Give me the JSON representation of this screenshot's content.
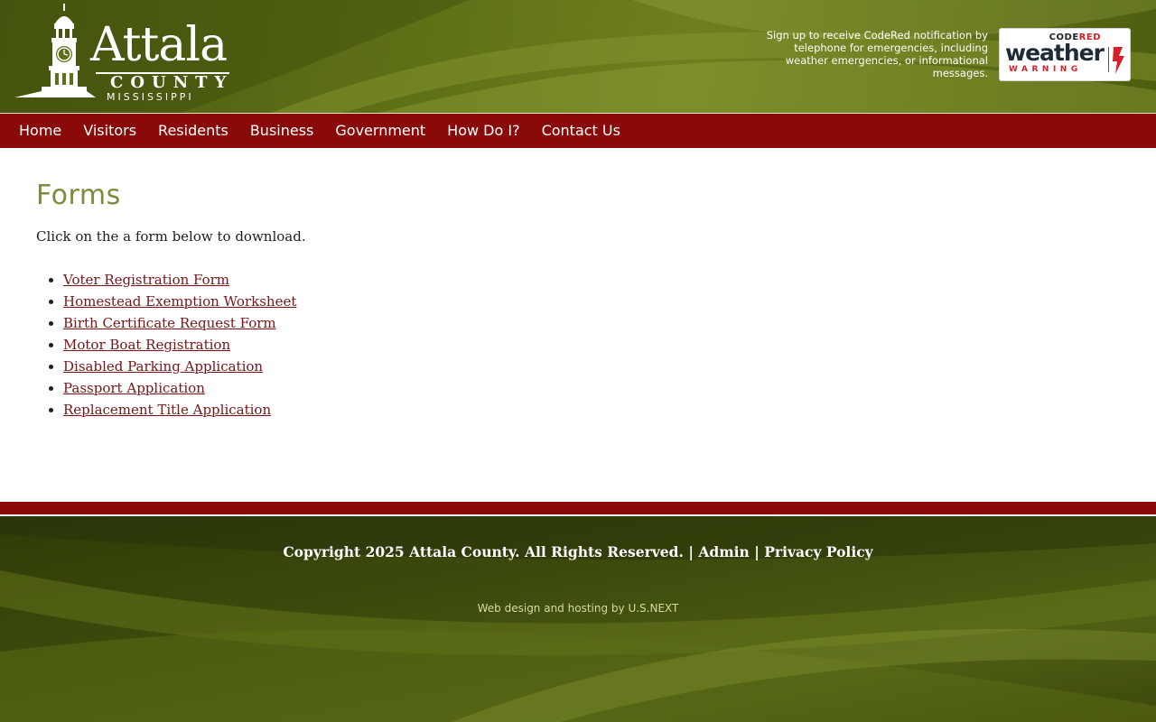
{
  "header": {
    "logo": {
      "word": "Attala",
      "county": "COUNTY",
      "state": "MISSISSIPPI"
    },
    "codered_text": "Sign up to receive CodeRed notification by telephone for emergencies, including weather emergencies, or informational messages.",
    "codered_badge": {
      "code": "CODE",
      "red": "RED",
      "weather": "weather",
      "warning": "WARNING"
    }
  },
  "nav": {
    "items": [
      "Home",
      "Visitors",
      "Residents",
      "Business",
      "Government",
      "How Do I?",
      "Contact Us"
    ]
  },
  "main": {
    "title": "Forms",
    "intro": "Click on the a form below to download.",
    "forms": [
      "Voter Registration Form",
      "Homestead Exemption Worksheet",
      "Birth Certificate Request Form",
      "Motor Boat Registration",
      "Disabled Parking Application",
      "Passport Application",
      "Replacement Title Application"
    ]
  },
  "footer": {
    "copyright": "Copyright 2025 Attala County. All Rights Reserved.",
    "separator": "|",
    "admin": "Admin",
    "privacy": "Privacy Policy",
    "credit_prefix": "Web design and hosting by",
    "credit_link": "U.S.NEXT"
  },
  "colors": {
    "brand_green": "#5e7016",
    "nav_red": "#8a0a0a",
    "title_green": "#7e8a3c",
    "link_red": "#7a1418"
  },
  "icons": [
    "courthouse-clock-tower-icon",
    "lightning-bolt-icon"
  ]
}
